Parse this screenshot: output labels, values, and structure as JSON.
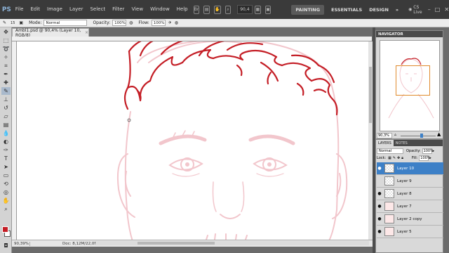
{
  "menubar": {
    "logo": "PS",
    "items": [
      "File",
      "Edit",
      "Image",
      "Layer",
      "Select",
      "Filter",
      "View",
      "Window",
      "Help"
    ],
    "zoom": "90,4",
    "workspaces": [
      "PAINTING",
      "ESSENTIALS",
      "DESIGN"
    ],
    "more": "»",
    "cs_live": "CS Live"
  },
  "options": {
    "brush_size": "15",
    "mode_label": "Mode:",
    "mode_value": "Normal",
    "opacity_label": "Opacity:",
    "opacity_value": "100%",
    "flow_label": "Flow:",
    "flow_value": "100%"
  },
  "document": {
    "tab_title": "Ambl1.psd @ 90,4% (Layer 10, RGB/8)",
    "tab_close": "×",
    "status_zoom": "90,39%",
    "status_doc": "Doc: 8,12M/22,0M"
  },
  "colors": {
    "foreground": "#c41d25",
    "background": "#ffffff",
    "sketch": "#f2c6cc",
    "ink": "#c41d25"
  },
  "navigator": {
    "title": "NAVIGATOR",
    "zoom": "90,3%"
  },
  "layers": {
    "tabs": [
      "LAYERS",
      "NOTES"
    ],
    "blend_mode": "Normal",
    "opacity_label": "Opacity:",
    "opacity_value": "100%",
    "lock_label": "Lock:",
    "fill_label": "Fill:",
    "fill_value": "100%",
    "items": [
      {
        "name": "Layer 10",
        "visible": true,
        "active": true
      },
      {
        "name": "Layer 9",
        "visible": false,
        "active": false
      },
      {
        "name": "Layer 8",
        "visible": true,
        "active": false
      },
      {
        "name": "Layer 7",
        "visible": true,
        "active": false
      },
      {
        "name": "Layer 2 copy",
        "visible": true,
        "active": false
      },
      {
        "name": "Layer 5",
        "visible": true,
        "active": false
      }
    ]
  }
}
